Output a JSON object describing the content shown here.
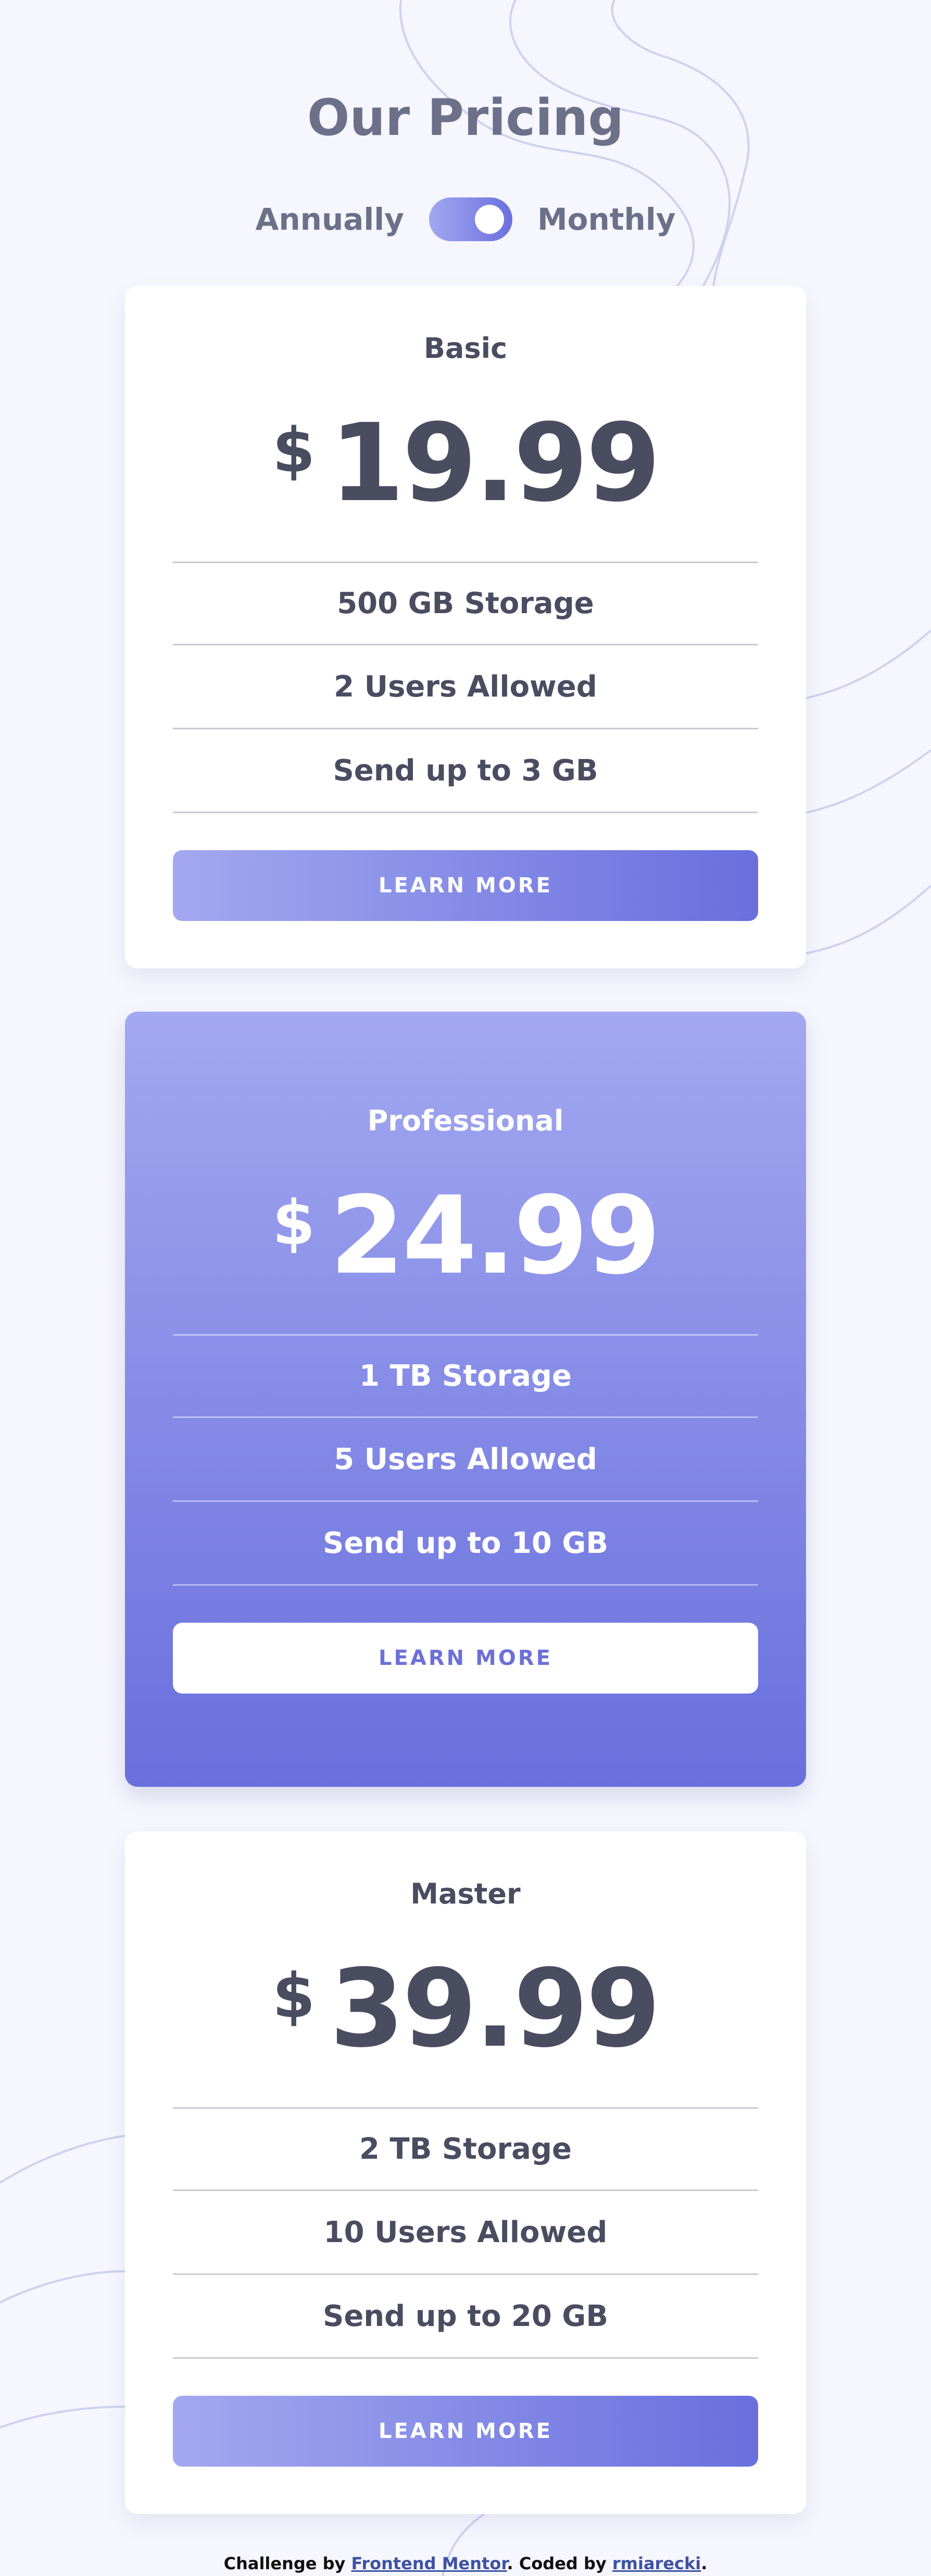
{
  "header": {
    "title": "Our Pricing",
    "toggle": {
      "left_label": "Annually",
      "right_label": "Monthly",
      "state": "monthly"
    }
  },
  "plans": [
    {
      "name": "Basic",
      "currency": "$",
      "price": "19.99",
      "features": [
        "500 GB Storage",
        "2 Users Allowed",
        "Send up to 3 GB"
      ],
      "button_label": "LEARN MORE"
    },
    {
      "name": "Professional",
      "currency": "$",
      "price": "24.99",
      "features": [
        "1 TB Storage",
        "5 Users Allowed",
        "Send up to 10 GB"
      ],
      "button_label": "LEARN MORE"
    },
    {
      "name": "Master",
      "currency": "$",
      "price": "39.99",
      "features": [
        "2 TB Storage",
        "10 Users Allowed",
        "Send up to 20 GB"
      ],
      "button_label": "LEARN MORE"
    }
  ],
  "footer": {
    "prefix": "Challenge by ",
    "challenge_link": "Frontend Mentor",
    "middle": ". Coded by ",
    "author_link": "rmiarecki",
    "suffix": "."
  },
  "colors": {
    "background": "#f6f6fe",
    "accent_start": "#a3a8f0",
    "accent_end": "#696fdd",
    "text_dark": "#4a4c60",
    "text_muted": "#6d7089"
  }
}
